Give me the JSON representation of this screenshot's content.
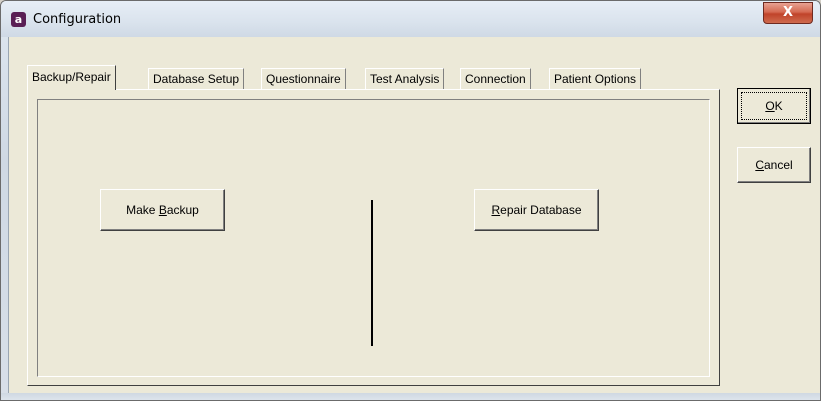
{
  "window": {
    "title": "Configuration",
    "app_icon_letter": "a",
    "close_label": "X"
  },
  "tabs": [
    {
      "label": "Backup/Repair",
      "active": true
    },
    {
      "label": "Database Setup",
      "active": false
    },
    {
      "label": "Questionnaire",
      "active": false
    },
    {
      "label": "Test Analysis",
      "active": false
    },
    {
      "label": "Connection",
      "active": false
    },
    {
      "label": "Patient Options",
      "active": false
    }
  ],
  "panel": {
    "make_backup": {
      "pre": "Make ",
      "mnemonic": "B",
      "post": "ackup"
    },
    "repair_database": {
      "pre": "",
      "mnemonic": "R",
      "post": "epair Database"
    }
  },
  "buttons": {
    "ok": {
      "pre": "",
      "mnemonic": "O",
      "post": "K"
    },
    "cancel": {
      "pre": "",
      "mnemonic": "C",
      "post": "ancel"
    }
  },
  "colors": {
    "close_button": "#c0432a",
    "app_icon": "#5a1f55",
    "dialog_face": "#ece9d8"
  }
}
